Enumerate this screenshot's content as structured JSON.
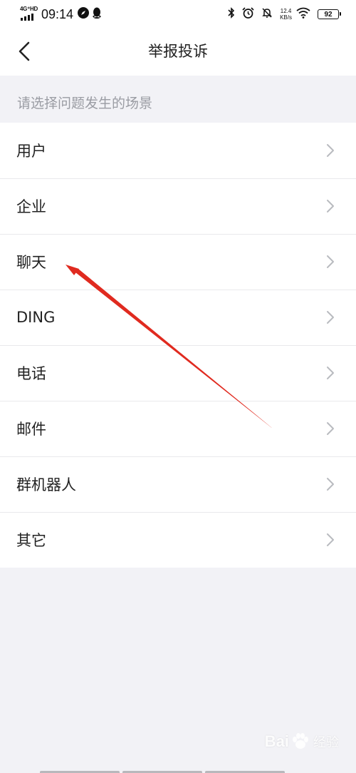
{
  "status_bar": {
    "network": "4G⁺HD",
    "time": "09:14",
    "speed_value": "12.4",
    "speed_unit": "KB/s",
    "battery": "92",
    "icons": [
      "compass-icon",
      "qq-penguin-icon",
      "bluetooth-icon",
      "alarm-icon",
      "mute-icon",
      "wifi-icon"
    ]
  },
  "nav": {
    "title": "举报投诉",
    "back_icon": "chevron-left-icon"
  },
  "section": {
    "header": "请选择问题发生的场景"
  },
  "list": {
    "items": [
      {
        "label": "用户"
      },
      {
        "label": "企业"
      },
      {
        "label": "聊天"
      },
      {
        "label": "DING"
      },
      {
        "label": "电话"
      },
      {
        "label": "邮件"
      },
      {
        "label": "群机器人"
      },
      {
        "label": "其它"
      }
    ]
  },
  "annotation": {
    "type": "red-arrow",
    "color": "#e02a1f",
    "points_to": "聊天"
  },
  "watermark": {
    "text_a": "Bai",
    "text_b": "经验"
  },
  "colors": {
    "background": "#f2f2f6",
    "surface": "#ffffff",
    "text_primary": "#222222",
    "text_secondary": "#9a9ca3",
    "chevron": "#b9bbc0",
    "divider": "#e9e9ec"
  }
}
